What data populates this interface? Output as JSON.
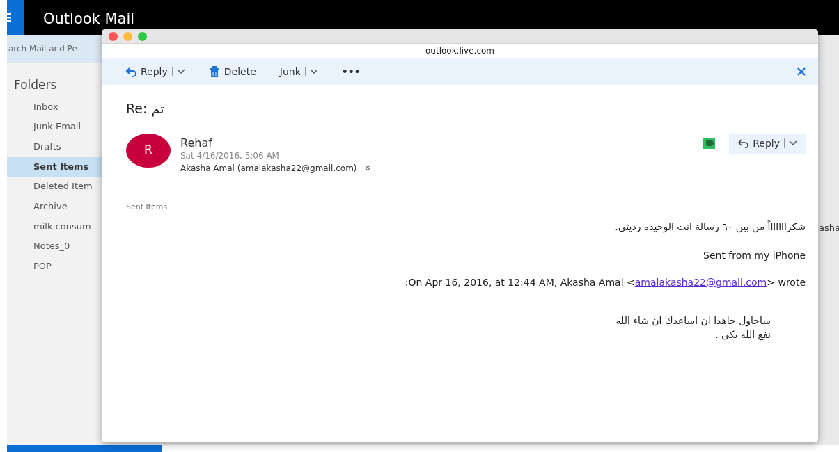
{
  "app": {
    "title": "Outlook Mail",
    "search_placeholder": "arch Mail and Pe"
  },
  "sidebar": {
    "heading": "Folders",
    "items": [
      {
        "label": "Inbox",
        "selected": false
      },
      {
        "label": "Junk Email",
        "selected": false
      },
      {
        "label": "Drafts",
        "selected": false
      },
      {
        "label": "Sent Items",
        "selected": true
      },
      {
        "label": "Deleted Item",
        "selected": false
      },
      {
        "label": "Archive",
        "selected": false
      },
      {
        "label": "milk consum",
        "selected": false
      },
      {
        "label": "Notes_0",
        "selected": false
      },
      {
        "label": "POP",
        "selected": false
      }
    ]
  },
  "background_fragment": "asha",
  "popup": {
    "address": "outlook.live.com",
    "toolbar": [
      {
        "kind": "reply",
        "label": "Reply"
      },
      {
        "kind": "delete",
        "label": "Delete"
      },
      {
        "kind": "junk",
        "label": "Junk"
      },
      {
        "kind": "more",
        "label": "•••"
      }
    ],
    "message": {
      "subject": "Re: تم",
      "avatar": "R",
      "sender": "Rehaf",
      "date": "Sat 4/16/2016, 5:06 AM",
      "recipient": "Akasha Amal (amalakasha22@gmail.com)",
      "reply_label": "Reply",
      "folder": "Sent Items",
      "body": [
        {
          "kind": "rtl",
          "text": "شكراااااااً من بين ٦٠ رسالة انت الوحيدة رديتي."
        },
        {
          "kind": "ltr",
          "text": "Sent from my iPhone"
        },
        {
          "kind": "quote_header",
          "before": ":On Apr 16, 2016, at 12:44 AM, Akasha Amal <",
          "link": "amalakasha22@gmail.com",
          "after": "> wrote"
        },
        {
          "kind": "quote",
          "lines": [
            "ساحاول جاهدا ان اساعدك ان شاء الله",
            "نفع الله بكى ."
          ]
        }
      ]
    }
  }
}
